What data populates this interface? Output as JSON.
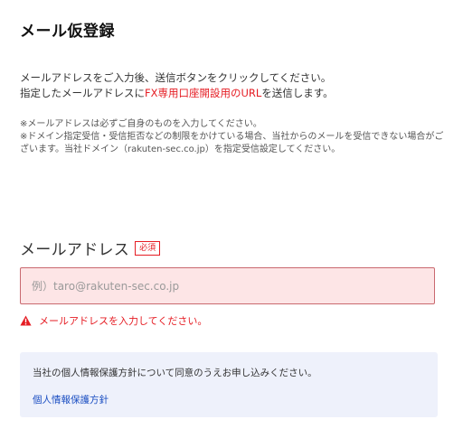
{
  "page": {
    "title": "メール仮登録"
  },
  "intro": {
    "line1": "メールアドレスをご入力後、送信ボタンをクリックしてください。",
    "line2_prefix": "指定したメールアドレスに",
    "line2_highlight": "FX専用口座開設用のURL",
    "line2_suffix": "を送信します。"
  },
  "notes": {
    "note1": "※メールアドレスは必ずご自身のものを入力してください。",
    "note2": "※ドメイン指定受信・受信拒否などの制限をかけている場合、当社からのメールを受信できない場合がございます。当社ドメイン（rakuten-sec.co.jp）を指定受信設定してください。"
  },
  "email_field": {
    "label": "メールアドレス",
    "required_badge": "必須",
    "value": "",
    "placeholder": "例）taro@rakuten-sec.co.jp",
    "error": "メールアドレスを入力してください。"
  },
  "privacy": {
    "text": "当社の個人情報保護方針について同意のうえお申し込みください。",
    "link": "個人情報保護方針"
  },
  "colors": {
    "accent_red": "#e51c23",
    "error_field_bg": "#fde5e6",
    "info_box_bg": "#eef1fb",
    "link_blue": "#1a4ec2"
  },
  "icons": {
    "error": "warning-triangle-icon"
  }
}
